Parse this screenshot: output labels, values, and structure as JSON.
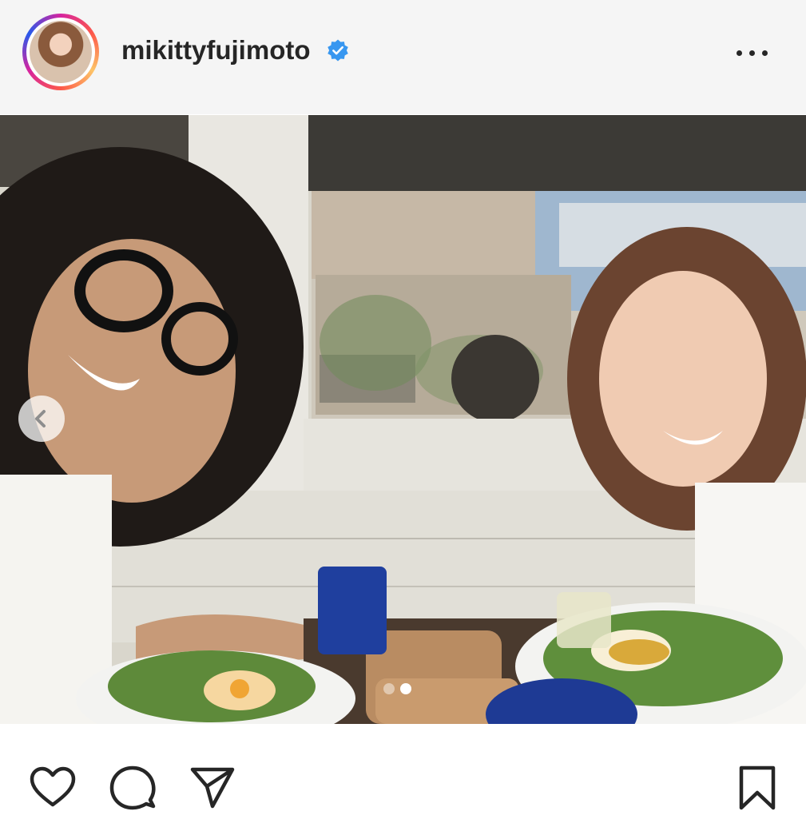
{
  "post": {
    "username": "mikittyfujimoto",
    "verified": true,
    "verified_color": "#3897f0",
    "avatar_alt": "profile-avatar",
    "carousel": {
      "current_index": 1,
      "total_visible_dots": 2
    }
  },
  "icons": {
    "more": "more-horizontal-icon",
    "prev": "chevron-left-icon",
    "like": "heart-icon",
    "comment": "comment-icon",
    "share": "send-icon",
    "save": "bookmark-icon"
  },
  "colors": {
    "text": "#262626",
    "header_bg": "#f5f5f5"
  }
}
